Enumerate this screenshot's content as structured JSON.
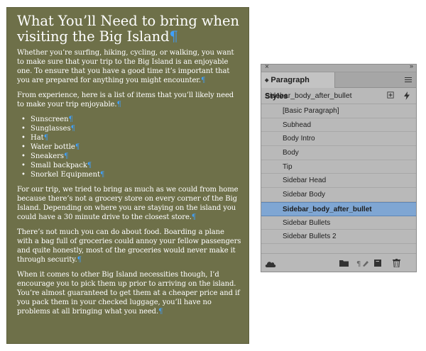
{
  "document": {
    "title": "What You’ll Need to bring when visiting the Big Island",
    "para1": "Whether you’re surfing, hiking, cycling, or walking, you want to make sure that your trip to the Big Island is an enjoyable one. To ensure that you have a good time it’s important that you are prepared for anything you might encounter.",
    "para2": "From experience, here is a list of items that you’ll likely need to make your trip enjoyable.",
    "items": [
      "Sunscreen",
      "Sunglasses",
      "Hat",
      "Water bottle",
      "Sneakers",
      "Small backpack",
      "Snorkel Equipment"
    ],
    "para3": "For our trip, we tried to bring as much as we could from home because there’s not a grocery store on every corner of the Big Island. Depending on where you are staying on the island you could have a 30 minute drive to the closest store.",
    "para4": "There’s not much you can do about food. Boarding a plane with a bag full of groceries could annoy your fellow passengers and quite honestly, most of the groceries would never make it through security.",
    "para5": "When it comes to other Big Island necessities though, I’d encourage you to pick them up prior to arriving on the island. You’re almost guaranteed to get them at a cheaper price and if you pack them in your checked luggage, you’ll have no problems at all bringing what you need.",
    "pilcrow": "¶",
    "colors": {
      "page": "#6e7049",
      "text": "#ffffff",
      "hidden_char": "#3fa0ff"
    }
  },
  "panel": {
    "tab_title": "Paragraph Styles",
    "current_style": "Sidebar_body_after_bullet",
    "styles": [
      "[Basic Paragraph]",
      "Subhead",
      "Body Intro",
      "Body",
      "Tip",
      "Sidebar Head",
      "Sidebar Body",
      "Sidebar_body_after_bullet",
      "Sidebar Bullets",
      "Sidebar Bullets 2"
    ],
    "selected_style": "Sidebar_body_after_bullet",
    "colors": {
      "background": "#b9b9b9",
      "selected_row": "#7fa6d3"
    },
    "icons": [
      "close-icon",
      "collapse-icon",
      "panel-menu-icon",
      "new-style-group-icon",
      "lightning-icon",
      "cloud-library-icon",
      "folder-icon",
      "clear-overrides-icon",
      "redefine-style-icon",
      "new-style-icon",
      "trash-icon"
    ]
  }
}
